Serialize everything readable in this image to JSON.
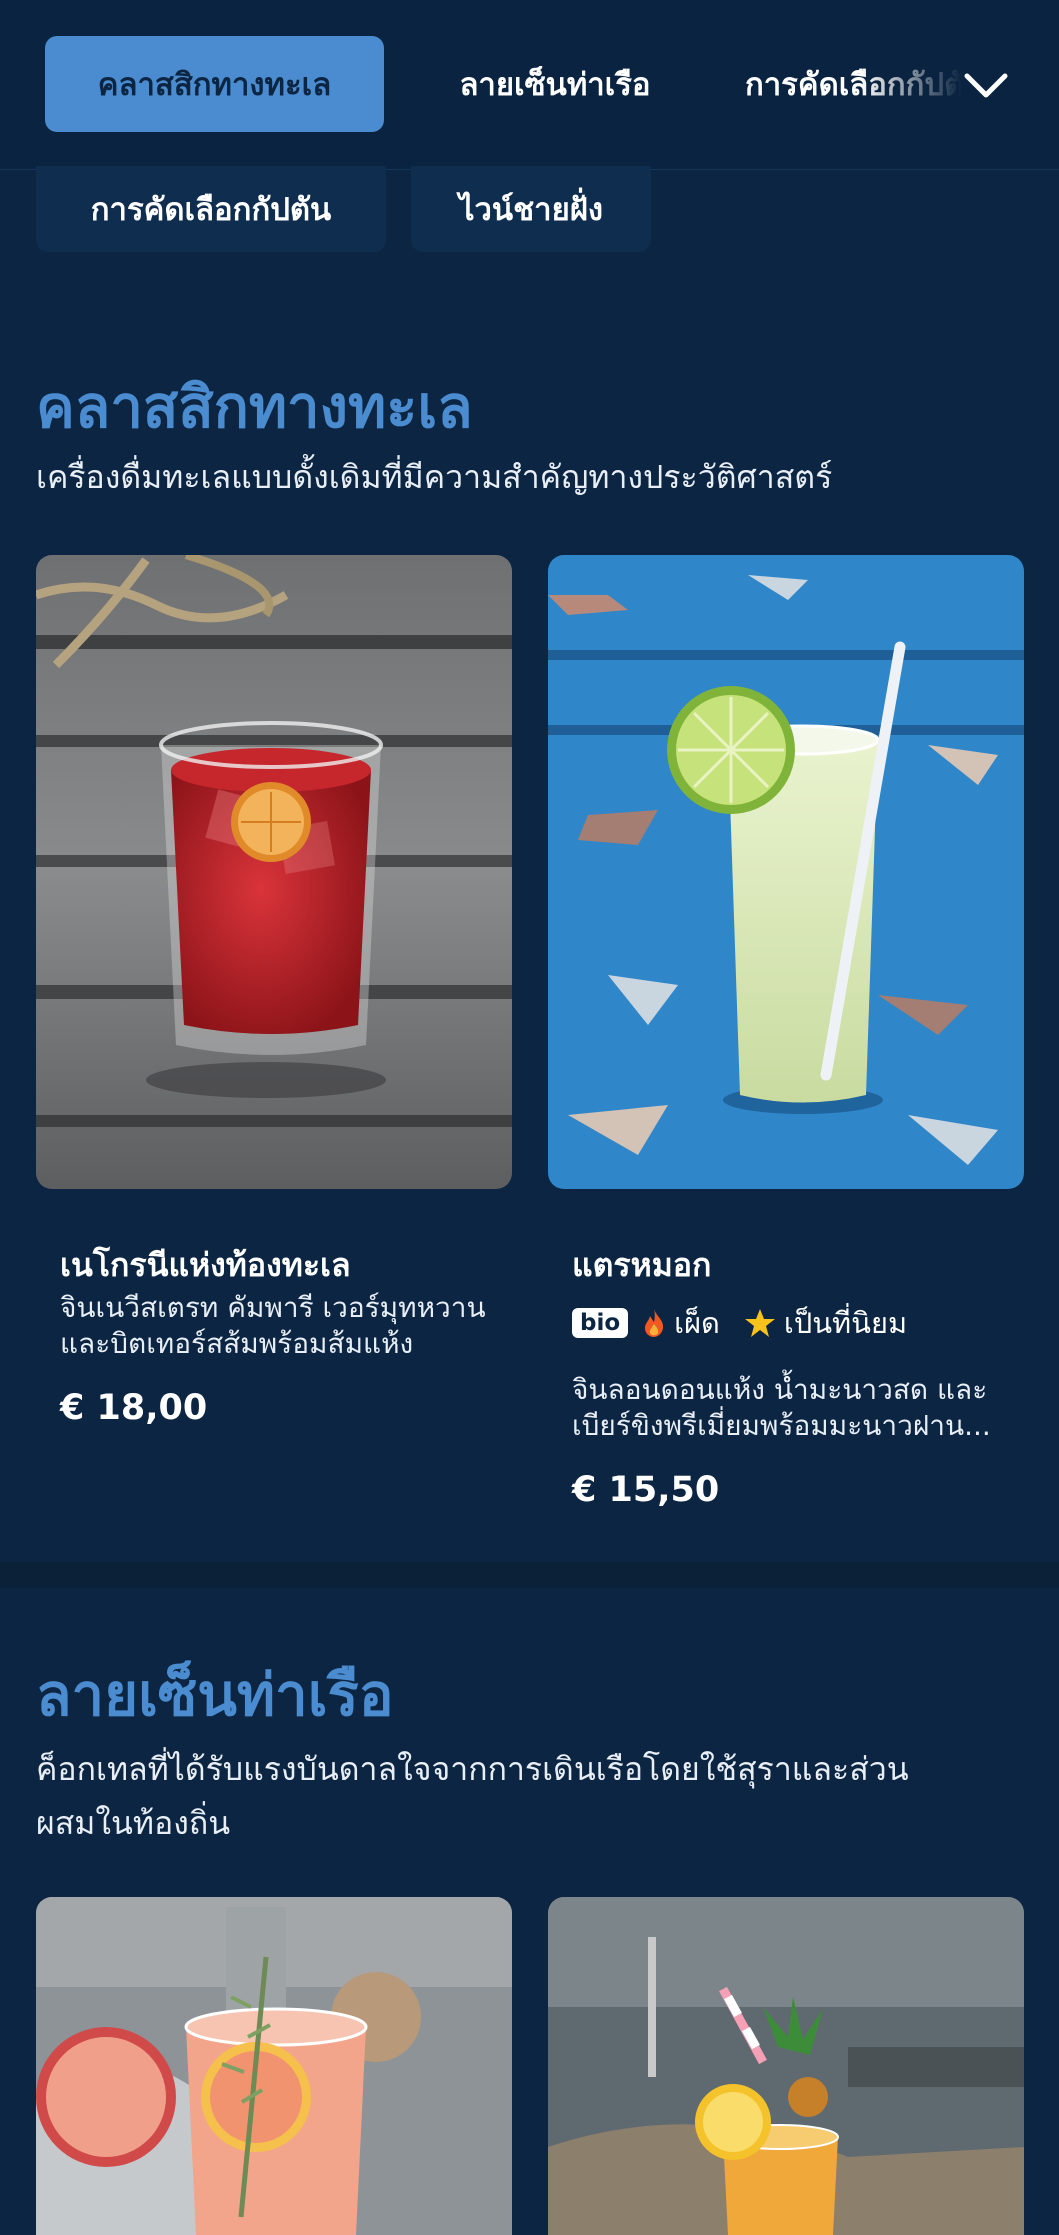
{
  "tabs": {
    "active": "คลาสสิกทางทะเล",
    "tab_2": "ลายเซ็นท่าเรือ",
    "tab_3": "การคัดเลือกกัปตัน",
    "chip_1": "การคัดเลือกกัปตัน",
    "chip_2": "ไวน์ชายฝั่ง",
    "chevron_icon": "chevron-down-icon"
  },
  "sections": [
    {
      "title": "คลาสสิกทางทะเล",
      "description": "เครื่องดื่มทะเลแบบดั้งเดิมที่มีความสำคัญทางประวัติศาสตร์",
      "items": [
        {
          "name": "เนโกรนีแห่งท้องทะเล",
          "description_line1": "จินเนวีสเตรท คัมพารี เวอร์มุทหวาน",
          "description_line2": "และบิตเทอร์สส้มพร้อมส้มแห้ง",
          "price": "€ 18,00"
        },
        {
          "name": "แตรหมอก",
          "tags": {
            "bio": "bio",
            "spicy": "เผ็ด",
            "popular": "เป็นที่นิยม"
          },
          "description_line1": "จินลอนดอนแห้ง น้ำมะนาวสด และ",
          "description_line2": "เบียร์ขิงพรีเมี่ยมพร้อมมะนาวฝาน...",
          "price": "€ 15,50"
        }
      ]
    },
    {
      "title": "ลายเซ็นท่าเรือ",
      "description_line1": "ค็อกเทลที่ได้รับแรงบันดาลใจจากการเดินเรือโดยใช้สุราและส่วน",
      "description_line2": "ผสมในท้องถิ่น"
    }
  ],
  "colors": {
    "background": "#0c2542",
    "accent": "#4a8ccf",
    "text": "#ffffff"
  }
}
